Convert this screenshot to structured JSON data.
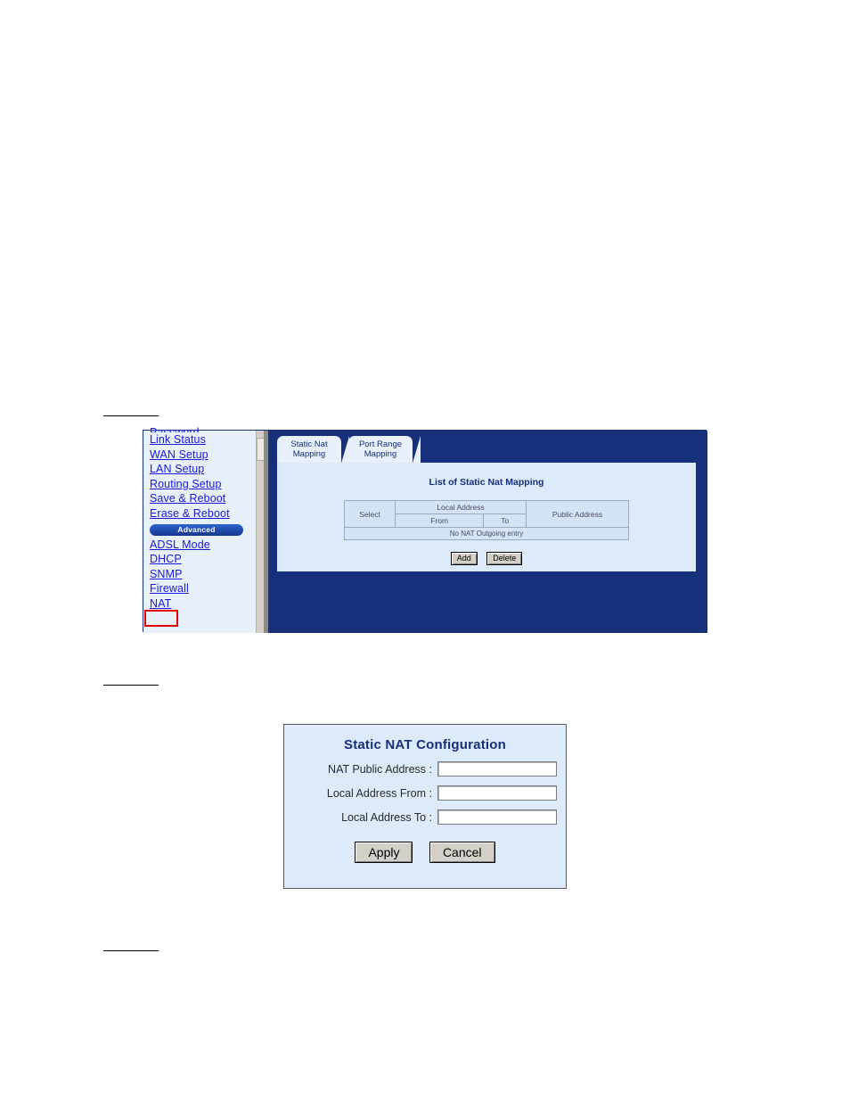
{
  "page": {
    "rule_marks": 3
  },
  "router_ui": {
    "nav": {
      "items": [
        {
          "label": "Password",
          "clipped": true
        },
        {
          "label": "Link Status",
          "clipped": false
        },
        {
          "label": "WAN Setup",
          "clipped": false
        },
        {
          "label": "LAN Setup",
          "clipped": false
        },
        {
          "label": "Routing Setup",
          "clipped": false
        },
        {
          "label": "Save & Reboot",
          "clipped": false
        },
        {
          "label": "Erase & Reboot",
          "clipped": false
        }
      ],
      "section_label": "Advanced",
      "advanced_items": [
        {
          "label": "ADSL Mode"
        },
        {
          "label": "DHCP"
        },
        {
          "label": "SNMP"
        },
        {
          "label": "Firewall"
        },
        {
          "label": "NAT"
        }
      ],
      "highlight_color": "#e00000",
      "highlighted_item": "NAT"
    },
    "tabs": [
      {
        "id": "static-nat-mapping",
        "line1": "Static Nat",
        "line2": "Mapping",
        "active": true
      },
      {
        "id": "port-range-mapping",
        "line1": "Port Range",
        "line2": "Mapping",
        "active": false
      }
    ],
    "panel": {
      "title": "List of Static Nat Mapping",
      "table": {
        "headers": {
          "select": "Select",
          "local_address": "Local Address",
          "local_from": "From",
          "local_to": "To",
          "public_address": "Public Address"
        },
        "rows": [],
        "empty_message": "No NAT Outgoing entry"
      },
      "buttons": [
        {
          "label": "Add"
        },
        {
          "label": "Delete"
        }
      ]
    }
  },
  "nat_dialog": {
    "title": "Static NAT Configuration",
    "fields": [
      {
        "label": "NAT Public Address :",
        "value": "",
        "placeholder": ""
      },
      {
        "label": "Local Address From :",
        "value": "",
        "placeholder": ""
      },
      {
        "label": "Local Address To :",
        "value": "",
        "placeholder": ""
      }
    ],
    "buttons": {
      "apply": "Apply",
      "cancel": "Cancel"
    }
  }
}
